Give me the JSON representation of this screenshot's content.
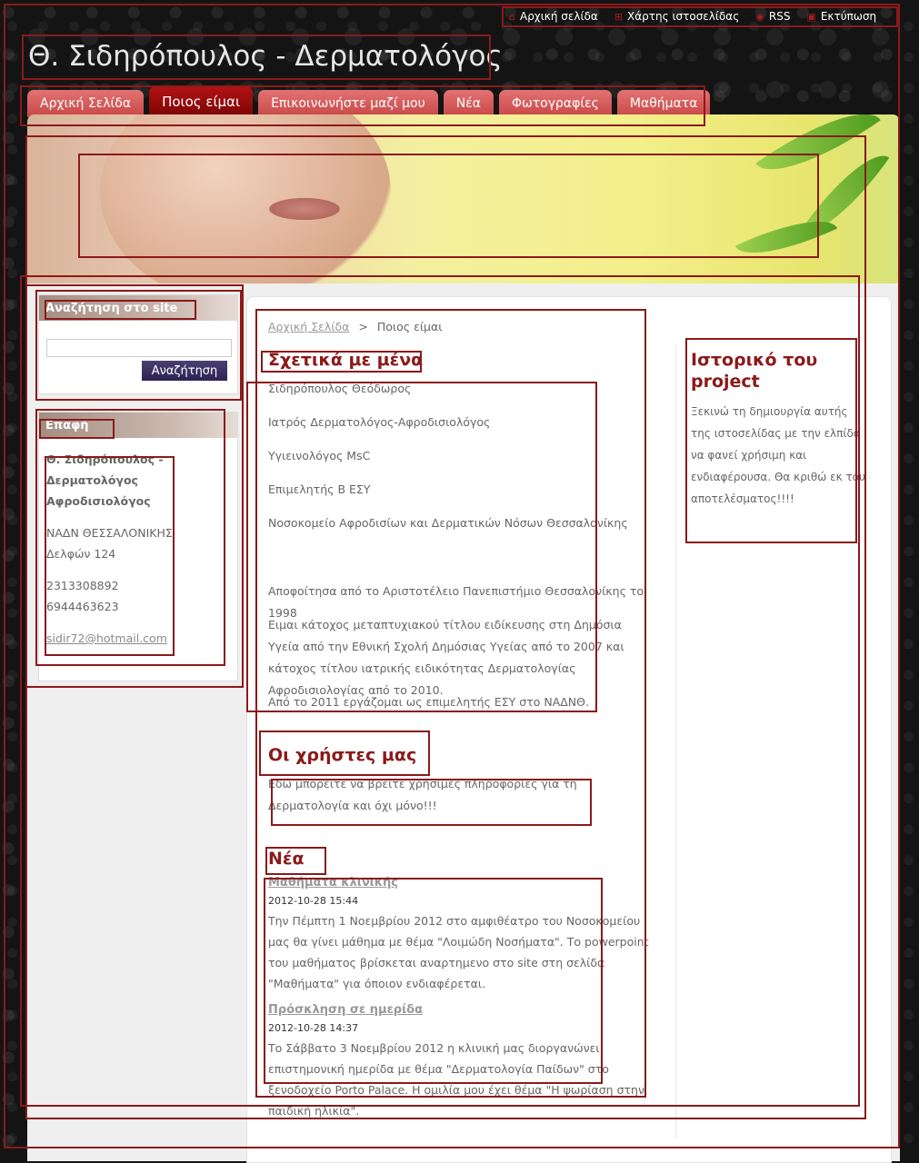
{
  "top_links": [
    {
      "label": "Αρχική σελίδα",
      "icon": "home-icon"
    },
    {
      "label": "Χάρτης ιστοσελίδας",
      "icon": "sitemap-icon"
    },
    {
      "label": "RSS",
      "icon": "rss-icon"
    },
    {
      "label": "Εκτύπωση",
      "icon": "print-icon"
    }
  ],
  "site_title": "Θ. Σιδηρόπουλος - Δερματολόγος",
  "nav": {
    "tabs": [
      {
        "label": "Αρχική Σελίδα",
        "active": false
      },
      {
        "label": "Ποιος είμαι",
        "active": true
      },
      {
        "label": "Επικοινωνήστε μαζί μου",
        "active": false
      },
      {
        "label": "Νέα",
        "active": false
      },
      {
        "label": "Φωτογραφίες",
        "active": false
      },
      {
        "label": "Μαθήματα",
        "active": false
      }
    ]
  },
  "sidebar": {
    "search": {
      "title": "Αναζήτηση στο site",
      "value": "",
      "button": "Αναζήτηση"
    },
    "contact": {
      "title": "Επαφή",
      "name_line1": "Θ. Σιδηρόπουλος -",
      "name_line2": "Δερματολόγος",
      "name_line3": "Αφροδισιολόγος",
      "addr1": "ΝΑΔΝ ΘΕΣΣΑΛΟΝΙΚΗΣ",
      "addr2": "Δελφών 124",
      "phone1": "2313308892",
      "phone2": "6944463623",
      "email": "sidir72@hotmail.com"
    }
  },
  "breadcrumb": {
    "home": "Αρχική Σελίδα",
    "separator": ">",
    "current": "Ποιος είμαι"
  },
  "about": {
    "title": "Σχετικά με μένα",
    "lines": [
      "Σιδηρόπουλος Θεόδωρος",
      "Ιατρός Δερματολόγος-Αφροδισιολόγος",
      "Υγιεινολόγος MsC",
      "Επιμελητής Β ΕΣΥ",
      "Νοσοκομείο Αφροδισίων και Δερματικών Νόσων Θεσσαλονίκης"
    ],
    "p1": "Αποφοίτησα από το Αριστοτέλειο Πανεπιστήμιο Θεσσαλονίκης το 1998",
    "p2": "Ειμαι κάτοχος μεταπτυχιακού τίτλου ειδίκευσης στη Δημόσια Υγεία από την Εθνική Σχολή Δημόσιας Υγείας από το 2007 και κάτοχος τίτλου ιατρικής ειδικότητας Δερματολογίας Αφροδισιολογίας από το 2010.",
    "p3": "Από το 2011 εργάζομαι ως επιμελητής ΕΣΥ στο ΝΑΔΝΘ."
  },
  "users": {
    "title": "Οι χρήστες μας",
    "text": "Εδώ μπορείτε να βρείτε χρήσιμες πληροφορίες για τη Δερματολογία και όχι μόνο!!!"
  },
  "news": {
    "title": "Νέα",
    "items": [
      {
        "title": "Μαθήματα κλινικής",
        "date": "2012-10-28 15:44",
        "text": "Την Πέμπτη 1 Νοεμβρίου 2012 στο αμφιθέατρο του Νοσοκομείου μας θα γίνει μάθημα με θέμα \"Λοιμώδη Νοσήματα\". Το powerpoint του μαθήματος βρίσκεται αναρτημενο στο site στη σελίδα \"Μαθήματα\" για όποιον ενδιαφέρεται."
      },
      {
        "title": "Πρόσκληση σε ημερίδα",
        "date": "2012-10-28 14:37",
        "text": "Το Σάββατο 3 Νοεμβρίου 2012 η κλινική μας διοργανώνει επιστημονική ημερίδα με θέμα \"Δερματολογία Παίδων\" στο ξενοδοχείο Porto Palace. Η ομιλία μου έχει θέμα \"Η ψωρίαση στην παιδική ηλικία\"."
      }
    ]
  },
  "history": {
    "title": "Ιστορικό του project",
    "text": "Ξεκινώ τη δημιουργία αυτής της ιστοσελίδας με την ελπίδα να φανεί χρήσιμη και ενδιαφέρουσα. Θα κριθώ εκ του αποτελέσματος!!!!"
  },
  "colors": {
    "accent": "#8b1a1a",
    "tab": "#d95a5a",
    "tab_active": "#9b0a0a",
    "button": "#2c2452"
  }
}
